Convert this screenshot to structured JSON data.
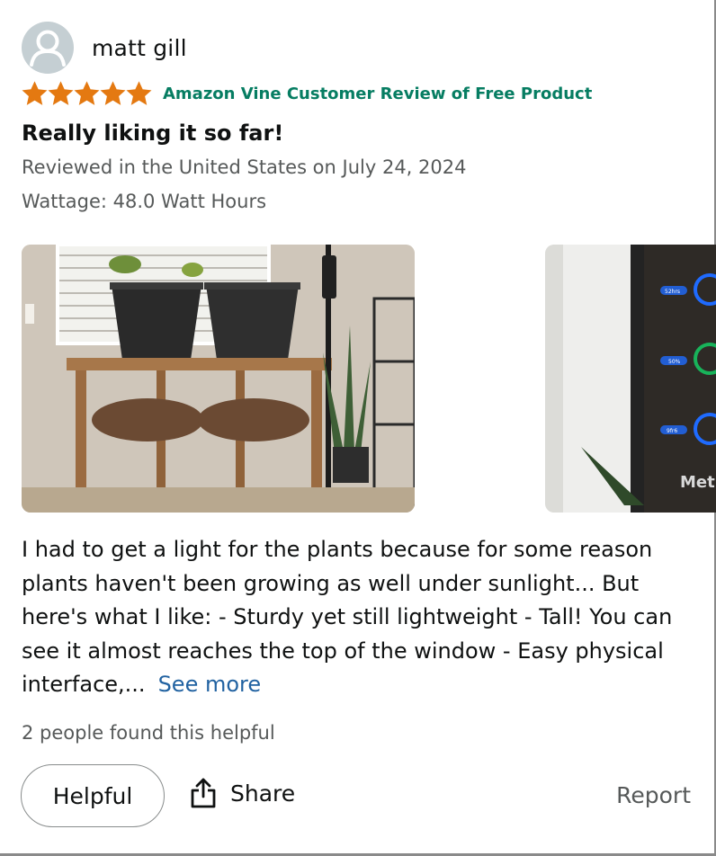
{
  "reviewer": {
    "name": "matt gill",
    "avatar_icon": "default-user-icon"
  },
  "rating": {
    "stars": 5,
    "max": 5,
    "star_color": "#e47911",
    "badge": "Amazon Vine Customer Review of Free Product",
    "badge_color": "#067d62"
  },
  "review": {
    "title": "Really liking it so far!",
    "date_line": "Reviewed in the United States on July 24, 2024",
    "variant": "Wattage: 48.0 Watt Hours",
    "body": "I had to get a light for the plants because for some reason plants haven't been growing as well under sunlight... But here's what I like: - Sturdy yet still lightweight - Tall! You can see it almost reaches the top of the window - Easy physical interface,...",
    "see_more": "See more",
    "link_color": "#2162a1"
  },
  "images": [
    {
      "name": "review-image-plants-table"
    },
    {
      "name": "review-image-lamp-controls",
      "visible_text": "Met",
      "control_labels": [
        "52hrs",
        "50%",
        "9fr6"
      ]
    }
  ],
  "helpful_count": "2 people found this helpful",
  "actions": {
    "helpful": "Helpful",
    "share": "Share",
    "share_icon": "share-icon",
    "report": "Report"
  }
}
